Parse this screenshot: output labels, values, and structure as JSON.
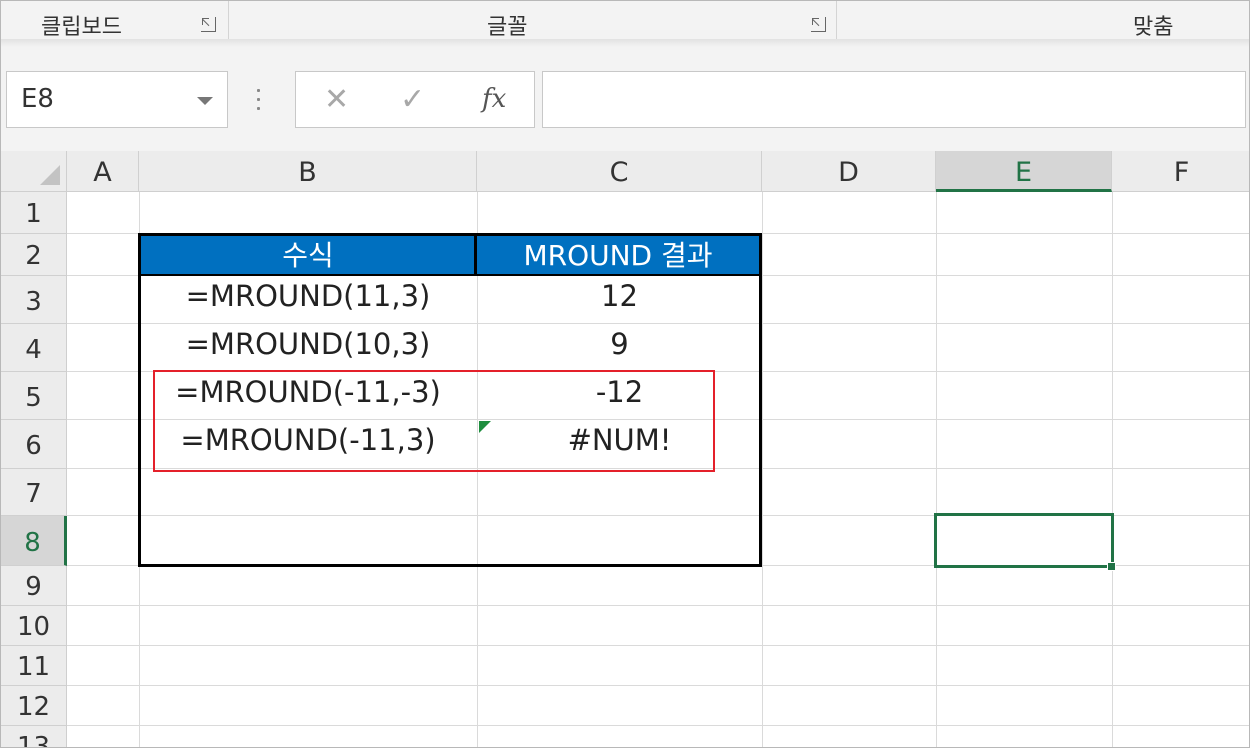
{
  "ribbon": {
    "groups": [
      {
        "label": "클립보드"
      },
      {
        "label": "글꼴"
      },
      {
        "label": "맞춤"
      }
    ]
  },
  "formula_bar": {
    "name_box": "E8",
    "cancel_glyph": "✕",
    "enter_glyph": "✓",
    "fx_label": "fx",
    "formula": ""
  },
  "columns": [
    "A",
    "B",
    "C",
    "D",
    "E",
    "F"
  ],
  "selected_column": "E",
  "rows": [
    "1",
    "2",
    "3",
    "4",
    "5",
    "6",
    "7",
    "8",
    "9",
    "10",
    "11",
    "12",
    "13"
  ],
  "selected_row": "8",
  "table": {
    "headers": [
      "수식",
      "MROUND 결과"
    ],
    "rows": [
      {
        "formula": "=MROUND(11,3)",
        "result": "12"
      },
      {
        "formula": "=MROUND(10,3)",
        "result": "9"
      },
      {
        "formula": "=MROUND(-11,-3)",
        "result": "-12"
      },
      {
        "formula": "=MROUND(-11,3)",
        "result": "#NUM!"
      }
    ]
  },
  "colors": {
    "header_fill": "#0070c0",
    "highlight_box": "#e4202a",
    "selection": "#217346"
  }
}
